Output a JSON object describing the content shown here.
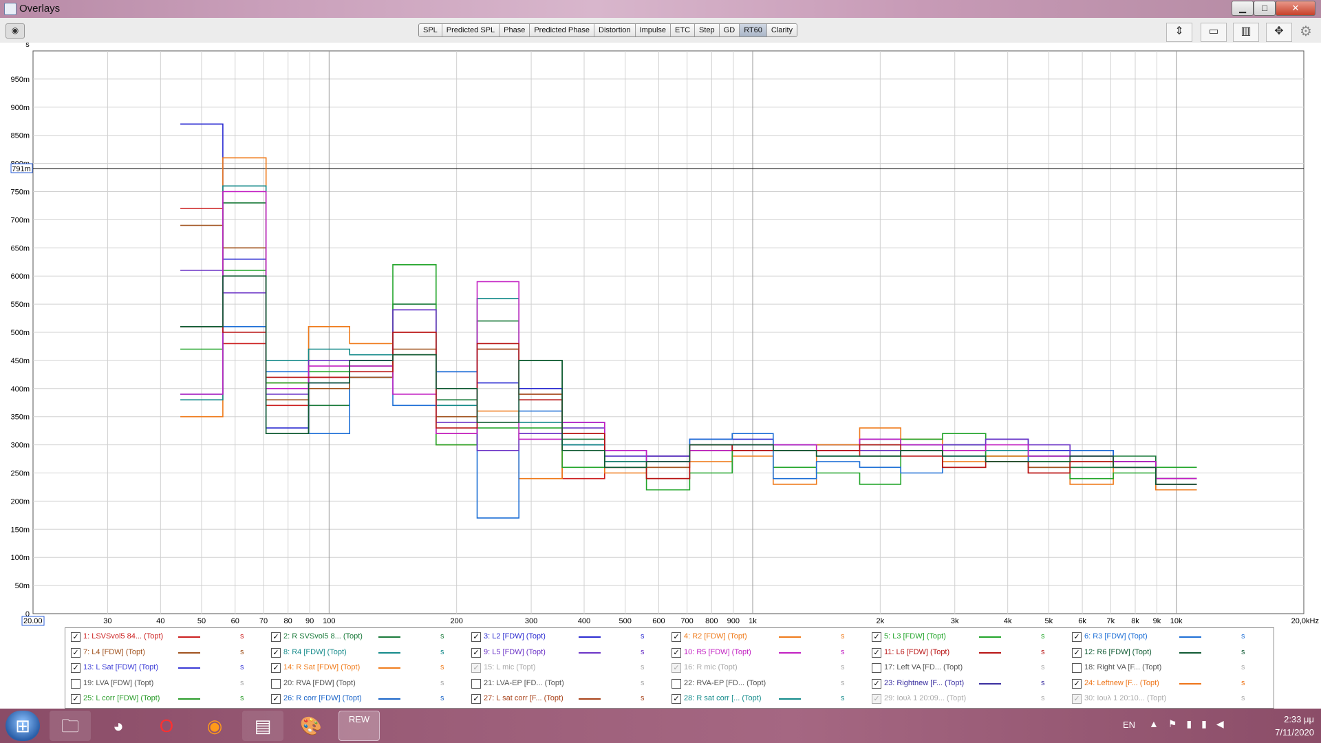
{
  "window": {
    "title": "Overlays",
    "minimize": "▁",
    "maximize": "□",
    "close": "✕"
  },
  "toolbar": {
    "tabs": [
      "SPL",
      "Predicted SPL",
      "Phase",
      "Predicted Phase",
      "Distortion",
      "Impulse",
      "ETC",
      "Step",
      "GD",
      "RT60",
      "Clarity"
    ],
    "active_tab": "RT60",
    "icons": [
      "camera-icon",
      "zoom-vertical-icon",
      "zoom-window-icon",
      "grid-icon",
      "fit-all-icon",
      "gear-icon"
    ]
  },
  "chart_data": {
    "type": "step",
    "y_unit": "s",
    "x_unit": "Hz",
    "ylim": [
      0,
      1.0
    ],
    "xlim": [
      20,
      20000
    ],
    "x_scale": "log",
    "grid": true,
    "y_ticks": [
      {
        "v": 0,
        "label": "0"
      },
      {
        "v": 0.05,
        "label": "50m"
      },
      {
        "v": 0.1,
        "label": "100m"
      },
      {
        "v": 0.15,
        "label": "150m"
      },
      {
        "v": 0.2,
        "label": "200m"
      },
      {
        "v": 0.25,
        "label": "250m"
      },
      {
        "v": 0.3,
        "label": "300m"
      },
      {
        "v": 0.35,
        "label": "350m"
      },
      {
        "v": 0.4,
        "label": "400m"
      },
      {
        "v": 0.45,
        "label": "450m"
      },
      {
        "v": 0.5,
        "label": "500m"
      },
      {
        "v": 0.55,
        "label": "550m"
      },
      {
        "v": 0.6,
        "label": "600m"
      },
      {
        "v": 0.65,
        "label": "650m"
      },
      {
        "v": 0.7,
        "label": "700m"
      },
      {
        "v": 0.75,
        "label": "750m"
      },
      {
        "v": 0.8,
        "label": "800m"
      },
      {
        "v": 0.85,
        "label": "850m"
      },
      {
        "v": 0.9,
        "label": "900m"
      },
      {
        "v": 0.95,
        "label": "950m"
      }
    ],
    "x_ticks": [
      {
        "v": 20,
        "label": "20.00"
      },
      {
        "v": 30,
        "label": "30"
      },
      {
        "v": 40,
        "label": "40"
      },
      {
        "v": 50,
        "label": "50"
      },
      {
        "v": 60,
        "label": "60"
      },
      {
        "v": 70,
        "label": "70"
      },
      {
        "v": 80,
        "label": "80"
      },
      {
        "v": 90,
        "label": "90"
      },
      {
        "v": 100,
        "label": "100"
      },
      {
        "v": 200,
        "label": "200"
      },
      {
        "v": 300,
        "label": "300"
      },
      {
        "v": 400,
        "label": "400"
      },
      {
        "v": 500,
        "label": "500"
      },
      {
        "v": 600,
        "label": "600"
      },
      {
        "v": 700,
        "label": "700"
      },
      {
        "v": 800,
        "label": "800"
      },
      {
        "v": 900,
        "label": "900"
      },
      {
        "v": 1000,
        "label": "1k"
      },
      {
        "v": 2000,
        "label": "2k"
      },
      {
        "v": 3000,
        "label": "3k"
      },
      {
        "v": 4000,
        "label": "4k"
      },
      {
        "v": 5000,
        "label": "5k"
      },
      {
        "v": 6000,
        "label": "6k"
      },
      {
        "v": 7000,
        "label": "7k"
      },
      {
        "v": 8000,
        "label": "8k"
      },
      {
        "v": 9000,
        "label": "9k"
      },
      {
        "v": 10000,
        "label": "10k"
      },
      {
        "v": 20000,
        "label": "20,0kHz"
      }
    ],
    "cursor": {
      "y": 0.791,
      "label": "791m"
    },
    "bands_hz": [
      50,
      63,
      80,
      100,
      125,
      160,
      200,
      250,
      315,
      400,
      500,
      630,
      800,
      1000,
      1250,
      1600,
      2000,
      2500,
      3150,
      4000,
      5000,
      6300,
      8000,
      10000
    ],
    "series": [
      {
        "color": "#cc1f1f",
        "values": [
          0.72,
          0.48,
          0.37,
          0.42,
          0.42,
          0.5,
          0.32,
          0.47,
          0.39,
          0.24,
          0.26,
          0.24,
          0.29,
          0.29,
          0.29,
          0.29,
          0.28,
          0.29,
          0.29,
          0.27,
          0.25,
          0.26,
          0.26,
          0.24
        ]
      },
      {
        "color": "#1a7a3a",
        "values": [
          0.51,
          0.73,
          0.32,
          0.37,
          0.44,
          0.55,
          0.38,
          0.52,
          0.45,
          0.31,
          0.27,
          0.28,
          0.3,
          0.3,
          0.3,
          0.3,
          0.3,
          0.3,
          0.3,
          0.28,
          0.26,
          0.26,
          0.28,
          0.24
        ]
      },
      {
        "color": "#2b2bd1",
        "values": [
          0.87,
          0.63,
          0.33,
          0.41,
          0.45,
          0.54,
          0.43,
          0.41,
          0.4,
          0.34,
          0.29,
          0.28,
          0.31,
          0.31,
          0.3,
          0.3,
          0.31,
          0.3,
          0.3,
          0.31,
          0.29,
          0.29,
          0.27,
          0.23
        ]
      },
      {
        "color": "#ef7a1a",
        "values": [
          0.35,
          0.81,
          0.41,
          0.51,
          0.48,
          0.46,
          0.3,
          0.36,
          0.24,
          0.3,
          0.25,
          0.26,
          0.27,
          0.28,
          0.23,
          0.3,
          0.33,
          0.31,
          0.27,
          0.28,
          0.28,
          0.23,
          0.27,
          0.22
        ]
      },
      {
        "color": "#22a52a",
        "values": [
          0.47,
          0.61,
          0.41,
          0.43,
          0.42,
          0.62,
          0.3,
          0.33,
          0.33,
          0.26,
          0.27,
          0.22,
          0.25,
          0.3,
          0.26,
          0.25,
          0.23,
          0.31,
          0.32,
          0.27,
          0.27,
          0.24,
          0.25,
          0.26
        ]
      },
      {
        "color": "#1d6fd6",
        "values": [
          0.39,
          0.51,
          0.43,
          0.32,
          0.42,
          0.37,
          0.43,
          0.17,
          0.36,
          0.3,
          0.28,
          0.27,
          0.31,
          0.32,
          0.24,
          0.27,
          0.26,
          0.25,
          0.28,
          0.27,
          0.28,
          0.29,
          0.26,
          0.23
        ]
      },
      {
        "color": "#a0521e",
        "values": [
          0.69,
          0.65,
          0.38,
          0.4,
          0.42,
          0.47,
          0.35,
          0.47,
          0.39,
          0.32,
          0.27,
          0.26,
          0.29,
          0.29,
          0.29,
          0.29,
          0.29,
          0.29,
          0.26,
          0.27,
          0.26,
          0.27,
          0.27,
          0.24
        ]
      },
      {
        "color": "#148a8a",
        "values": [
          0.38,
          0.76,
          0.45,
          0.47,
          0.46,
          0.46,
          0.37,
          0.56,
          0.34,
          0.3,
          0.27,
          0.27,
          0.29,
          0.3,
          0.29,
          0.28,
          0.28,
          0.29,
          0.3,
          0.29,
          0.28,
          0.28,
          0.27,
          0.24
        ]
      },
      {
        "color": "#6b33c6",
        "values": [
          0.61,
          0.57,
          0.39,
          0.45,
          0.45,
          0.54,
          0.34,
          0.29,
          0.32,
          0.33,
          0.28,
          0.28,
          0.3,
          0.29,
          0.29,
          0.29,
          0.29,
          0.29,
          0.3,
          0.31,
          0.3,
          0.28,
          0.27,
          0.24
        ]
      },
      {
        "color": "#c21fc2",
        "values": [
          0.39,
          0.75,
          0.4,
          0.44,
          0.44,
          0.39,
          0.32,
          0.59,
          0.31,
          0.34,
          0.29,
          0.27,
          0.29,
          0.3,
          0.3,
          0.29,
          0.31,
          0.3,
          0.29,
          0.3,
          0.28,
          0.28,
          0.27,
          0.24
        ]
      },
      {
        "color": "#b81414",
        "values": [
          0.51,
          0.5,
          0.42,
          0.42,
          0.43,
          0.5,
          0.33,
          0.48,
          0.38,
          0.32,
          0.26,
          0.24,
          0.3,
          0.29,
          0.29,
          0.29,
          0.3,
          0.28,
          0.26,
          0.27,
          0.25,
          0.27,
          0.26,
          0.23
        ]
      },
      {
        "color": "#0f5a32",
        "values": [
          0.51,
          0.6,
          0.32,
          0.41,
          0.45,
          0.46,
          0.4,
          0.34,
          0.45,
          0.29,
          0.26,
          0.27,
          0.3,
          0.3,
          0.29,
          0.28,
          0.28,
          0.29,
          0.28,
          0.27,
          0.27,
          0.28,
          0.26,
          0.23
        ]
      }
    ]
  },
  "legend": {
    "unit": "s",
    "items": [
      {
        "label": "1: LSVSvol5 84... (Topt)",
        "color": "#cc1f1f",
        "checked": true,
        "active": true
      },
      {
        "label": "2: R SVSvol5 8... (Topt)",
        "color": "#1a7a3a",
        "checked": true,
        "active": true
      },
      {
        "label": "3: L2 [FDW] (Topt)",
        "color": "#2b2bd1",
        "checked": true,
        "active": true
      },
      {
        "label": "4: R2 [FDW] (Topt)",
        "color": "#ef7a1a",
        "checked": true,
        "active": true
      },
      {
        "label": "5: L3 [FDW] (Topt)",
        "color": "#22a52a",
        "checked": true,
        "active": true
      },
      {
        "label": "6: R3 [FDW] (Topt)",
        "color": "#1d6fd6",
        "checked": true,
        "active": true
      },
      {
        "label": "7: L4 [FDW] (Topt)",
        "color": "#a0521e",
        "checked": true,
        "active": true
      },
      {
        "label": "8: R4 [FDW] (Topt)",
        "color": "#148a8a",
        "checked": true,
        "active": true
      },
      {
        "label": "9: L5 [FDW] (Topt)",
        "color": "#6b33c6",
        "checked": true,
        "active": true
      },
      {
        "label": "10: R5 [FDW] (Topt)",
        "color": "#c21fc2",
        "checked": true,
        "active": true
      },
      {
        "label": "11: L6 [FDW] (Topt)",
        "color": "#b81414",
        "checked": true,
        "active": true
      },
      {
        "label": "12: R6 [FDW] (Topt)",
        "color": "#0f5a32",
        "checked": true,
        "active": true
      },
      {
        "label": "13: L Sat [FDW] (Topt)",
        "color": "#3a3ad6",
        "checked": true,
        "active": true
      },
      {
        "label": "14: R Sat [FDW] (Topt)",
        "color": "#f07d1e",
        "checked": true,
        "active": true
      },
      {
        "label": "15: L mic (Topt)",
        "color": "",
        "checked": true,
        "active": false
      },
      {
        "label": "16: R mic (Topt)",
        "color": "",
        "checked": true,
        "active": false
      },
      {
        "label": "17: Left VA [FD... (Topt)",
        "color": "",
        "checked": false,
        "active": true
      },
      {
        "label": "18: Right VA [F... (Topt)",
        "color": "",
        "checked": false,
        "active": true
      },
      {
        "label": "19: LVA [FDW] (Topt)",
        "color": "",
        "checked": false,
        "active": true
      },
      {
        "label": "20: RVA [FDW] (Topt)",
        "color": "",
        "checked": false,
        "active": true
      },
      {
        "label": "21: LVA-EP [FD... (Topt)",
        "color": "",
        "checked": false,
        "active": true
      },
      {
        "label": "22: RVA-EP [FD... (Topt)",
        "color": "",
        "checked": false,
        "active": true
      },
      {
        "label": "23: Rightnew [F... (Topt)",
        "color": "#3a2fa0",
        "checked": true,
        "active": true
      },
      {
        "label": "24: Leftnew [F... (Topt)",
        "color": "#ee7418",
        "checked": true,
        "active": true
      },
      {
        "label": "25: L corr [FDW] (Topt)",
        "color": "#2a9c2a",
        "checked": true,
        "active": true
      },
      {
        "label": "26: R corr [FDW] (Topt)",
        "color": "#1a64c8",
        "checked": true,
        "active": true
      },
      {
        "label": "27: L sat corr [F... (Topt)",
        "color": "#a8421a",
        "checked": true,
        "active": true
      },
      {
        "label": "28: R sat corr [... (Topt)",
        "color": "#128a8a",
        "checked": true,
        "active": true
      },
      {
        "label": "29: Ιουλ 1 20:09... (Topt)",
        "color": "",
        "checked": true,
        "active": false
      },
      {
        "label": "30: Ιουλ 1 20:10... (Topt)",
        "color": "",
        "checked": true,
        "active": false
      }
    ]
  },
  "taskbar": {
    "apps": [
      "windows-start-icon",
      "explorer-icon",
      "chrome-icon",
      "opera-icon",
      "avast-browser-icon",
      "winrar-icon",
      "paint-icon",
      "rew-icon"
    ],
    "rew_label": "REW",
    "language": "EN",
    "time": "2:33 μμ",
    "date": "7/11/2020"
  }
}
